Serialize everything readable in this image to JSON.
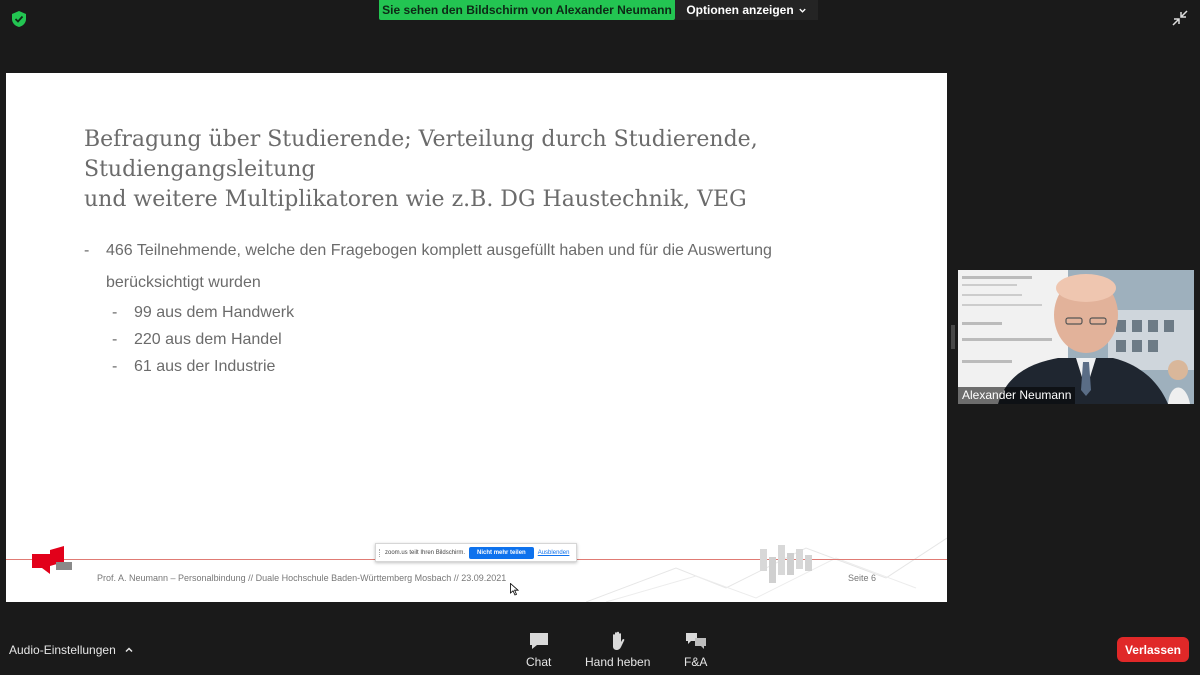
{
  "topbar": {
    "share_banner": "Sie sehen den Bildschirm von Alexander Neumann",
    "options_label": "Optionen anzeigen"
  },
  "slide": {
    "title_line1": "Befragung über Studierende; Verteilung durch Studierende, Studiengangsleitung",
    "title_line2": "und weitere Multiplikatoren wie z.B. DG Haustechnik, VEG",
    "bullet_dash": "-",
    "main_bullet_line1": "466 Teilnehmende, welche den Fragebogen komplett ausgefüllt haben und für die Auswertung",
    "main_bullet_line2": "berücksichtigt wurden",
    "sub_bullets": [
      "99 aus dem Handwerk",
      "220 aus dem Handel",
      "61 aus der Industrie"
    ],
    "footer": "Prof. A. Neumann – Personalbindung // Duale Hochschule Baden-Württemberg Mosbach // 23.09.2021",
    "page_number": "Seite  6"
  },
  "sharebar": {
    "status": "zoom.us teilt Ihren Bildschirm.",
    "stop_label": "Nicht mehr teilen",
    "hide_label": "Ausblenden"
  },
  "video": {
    "participant_name": "Alexander Neumann"
  },
  "toolbar": {
    "audio_label": "Audio-Einstellungen",
    "chat_label": "Chat",
    "raise_hand_label": "Hand heben",
    "qa_label": "F&A",
    "leave_label": "Verlassen"
  },
  "colors": {
    "share_green": "#23c552",
    "leave_red": "#e02828",
    "accent_blue": "#0e72ed",
    "dhbw_red": "#e2001a"
  }
}
